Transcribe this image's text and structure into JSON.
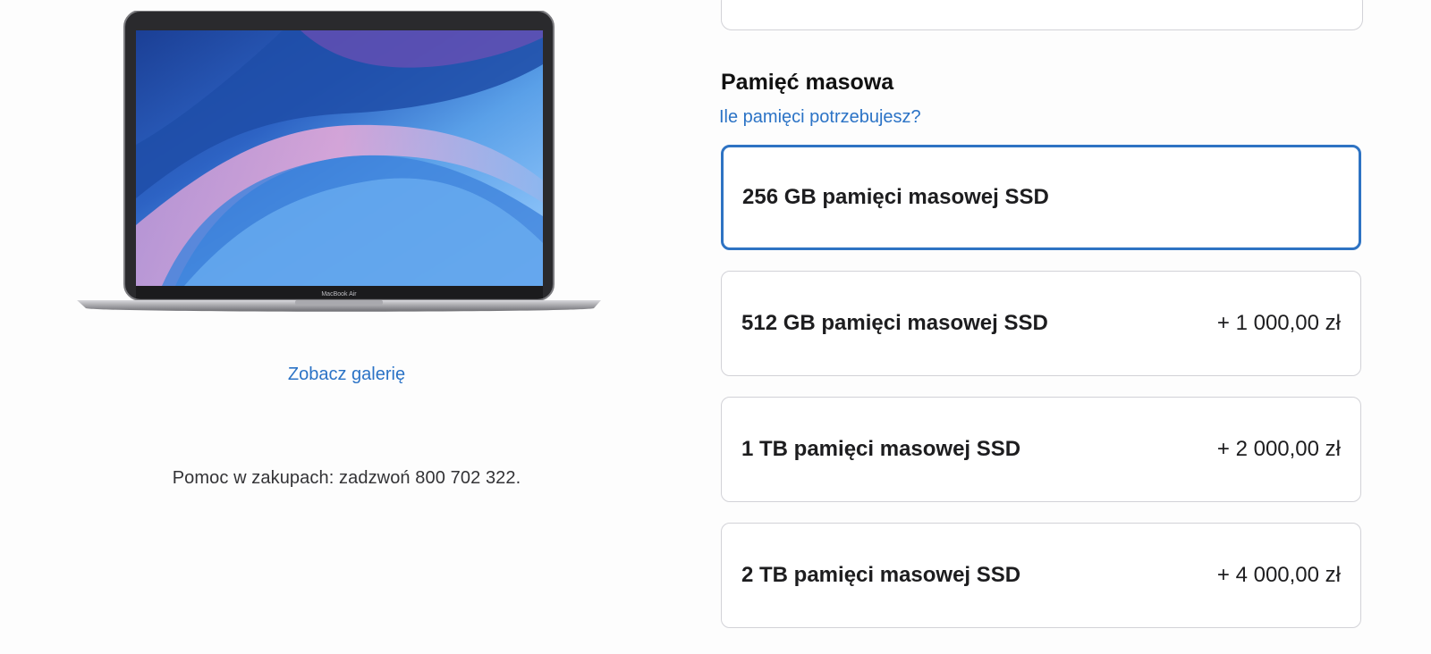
{
  "left": {
    "product_image": {
      "name": "MacBook Air",
      "screen_label": "MacBook Air"
    },
    "gallery_link": "Zobacz galerię",
    "help_text": "Pomoc w zakupach: zadzwoń 800 702 322."
  },
  "storage": {
    "title": "Pamięć masowa",
    "help_link": "Ile pamięci potrzebujesz?",
    "options": [
      {
        "label": "256 GB pamięci masowej SSD",
        "price": "",
        "selected": true
      },
      {
        "label": "512 GB pamięci masowej SSD",
        "price": "+ 1 000,00 zł",
        "selected": false
      },
      {
        "label": "1 TB pamięci masowej SSD",
        "price": "+ 2 000,00 zł",
        "selected": false
      },
      {
        "label": "2 TB pamięci masowej SSD",
        "price": "+ 4 000,00 zł",
        "selected": false
      }
    ]
  },
  "colors": {
    "accent": "#2e73c3",
    "link": "#2b73c6",
    "border": "#d2d2d7"
  }
}
